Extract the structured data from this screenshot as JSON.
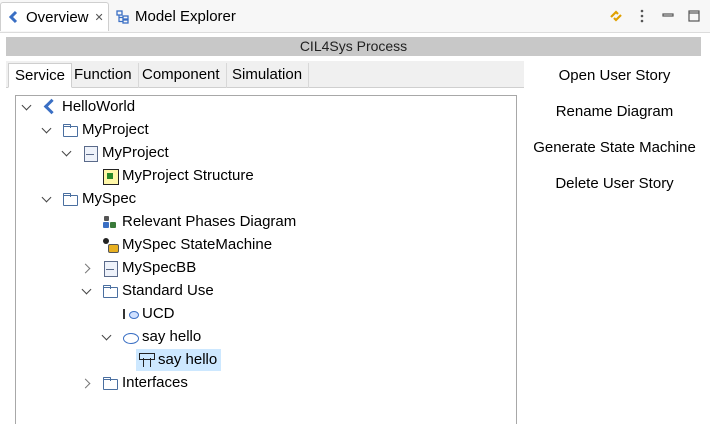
{
  "view_tabs": {
    "overview": {
      "label": "Overview",
      "icon": "overview-icon"
    },
    "model_explorer": {
      "label": "Model Explorer",
      "icon": "model-explorer-icon"
    }
  },
  "process_title": "CIL4Sys Process",
  "inner_tabs": [
    "Service",
    "Function",
    "Component",
    "Simulation"
  ],
  "active_inner_tab": "Service",
  "tree": [
    {
      "label": "HelloWorld",
      "level": 0,
      "expanded": true,
      "icon": "helloworld-icon"
    },
    {
      "label": "MyProject",
      "level": 1,
      "expanded": true,
      "icon": "folder-icon"
    },
    {
      "label": "MyProject",
      "level": 2,
      "expanded": true,
      "icon": "model-icon"
    },
    {
      "label": "MyProject Structure",
      "level": 3,
      "expanded": null,
      "icon": "structure-diagram-icon"
    },
    {
      "label": "MySpec",
      "level": 1,
      "expanded": true,
      "icon": "folder-icon"
    },
    {
      "label": "Relevant Phases Diagram",
      "level": 2,
      "expanded": null,
      "icon": "phases-diagram-icon"
    },
    {
      "label": "MySpec StateMachine",
      "level": 2,
      "expanded": null,
      "icon": "state-machine-icon"
    },
    {
      "label": "MySpecBB",
      "level": 2,
      "expanded": false,
      "icon": "model-icon"
    },
    {
      "label": "Standard Use",
      "level": 2,
      "expanded": true,
      "icon": "folder-icon"
    },
    {
      "label": "UCD",
      "level": 3,
      "expanded": null,
      "icon": "use-case-diagram-icon"
    },
    {
      "label": "say hello",
      "level": 3,
      "expanded": true,
      "icon": "use-case-icon"
    },
    {
      "label": "say hello",
      "level": 4,
      "expanded": null,
      "icon": "sequence-diagram-icon",
      "selected": true
    },
    {
      "label": "Interfaces",
      "level": 2,
      "expanded": false,
      "icon": "folder-icon"
    }
  ],
  "actions": [
    "Open User Story",
    "Rename Diagram",
    "Generate State Machine",
    "Delete User Story"
  ],
  "colors": {
    "selection": "#cde8ff",
    "title_band": "#c8c8c8",
    "accent": "#3a6fc4"
  }
}
